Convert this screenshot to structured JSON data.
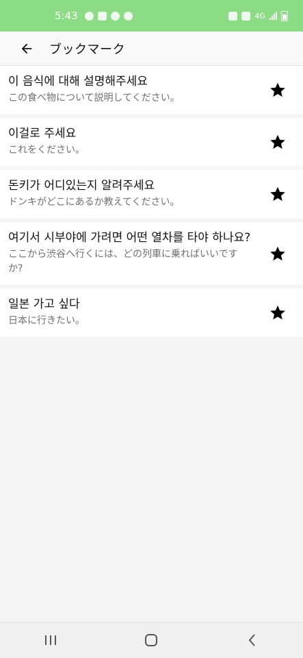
{
  "status_bar": {
    "time": "5:43",
    "network": "4G"
  },
  "header": {
    "title": "ブックマーク",
    "back_icon": "arrow-left-icon"
  },
  "bookmarks": [
    {
      "korean": "이 음식에 대해 설명해주세요",
      "japanese": "この食べ物について説明してください。",
      "icon": "star-icon"
    },
    {
      "korean": "이걸로 주세요",
      "japanese": "これをください。",
      "icon": "star-icon"
    },
    {
      "korean": "돈키가 어디있는지 알려주세요",
      "japanese": "ドンキがどこにあるか教えてください。",
      "icon": "star-icon"
    },
    {
      "korean": "여기서 시부야에 가려면 어떤 열차를 타야 하나요?",
      "japanese": "ここから渋谷へ行くには、どの列車に乗ればいいですか?",
      "icon": "star-icon"
    },
    {
      "korean": "일본 가고 싶다",
      "japanese": "日本に行きたい。",
      "icon": "star-icon"
    }
  ],
  "nav_bar": {
    "recents_icon": "recents-icon",
    "home_icon": "home-icon",
    "back_icon": "back-chevron-icon"
  },
  "colors": {
    "status_bar": "#8bdc84",
    "card": "#ffffff",
    "background": "#f5f5f5",
    "title_text": "#111111",
    "subtitle_text": "#6f6f6f"
  }
}
